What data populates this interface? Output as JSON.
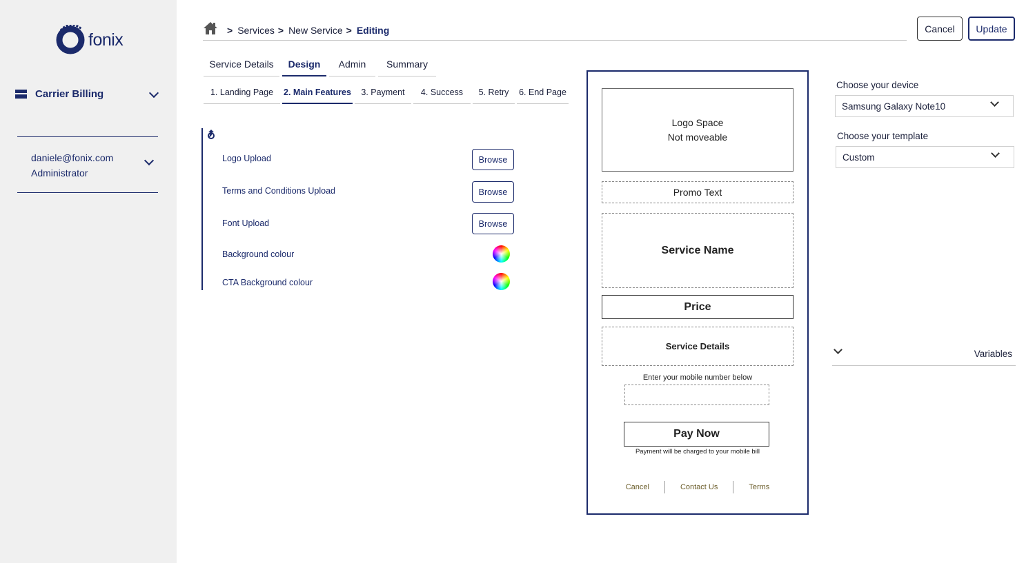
{
  "sidebar": {
    "brand": "fonix",
    "section_label": "Carrier Billing",
    "user_email": "daniele@fonix.com",
    "user_role": "Administrator"
  },
  "breadcrumb": {
    "items": [
      "Services",
      "New Service",
      "Editing"
    ],
    "separator": ">"
  },
  "toolbar": {
    "cancel_label": "Cancel",
    "update_label": "Update"
  },
  "tabs": [
    "Service Details",
    "Design",
    "Admin",
    "Summary"
  ],
  "active_tab": "Design",
  "subtabs": [
    "1. Landing Page",
    "2. Main Features",
    "3. Payment",
    "4. Success",
    "5. Retry",
    "6. End Page"
  ],
  "active_subtab": "2. Main Features",
  "features": {
    "logo_upload": "Logo Upload",
    "terms_upload": "Terms and Conditions Upload",
    "font_upload": "Font Upload",
    "background_colour": "Background colour",
    "cta_background_colour": "CTA Background colour",
    "browse_label": "Browse"
  },
  "preview": {
    "logo_line1": "Logo Space",
    "logo_line2": "Not moveable",
    "promo": "Promo Text",
    "service_name": "Service Name",
    "price": "Price",
    "service_details": "Service Details",
    "enter_mobile": "Enter your mobile number below",
    "pay_now": "Pay Now",
    "charge_note": "Payment will be charged to your mobile bill",
    "footer_cancel": "Cancel",
    "footer_contact": "Contact Us",
    "footer_terms": "Terms"
  },
  "settings": {
    "device_label": "Choose your device",
    "device_value": "Samsung Galaxy Note10",
    "template_label": "Choose your template",
    "template_value": "Custom",
    "variables_label": "Variables"
  },
  "colors": {
    "brand": "#1b2a6b",
    "sidebar_bg": "#f0f0f0",
    "link": "#6b5d2a"
  }
}
